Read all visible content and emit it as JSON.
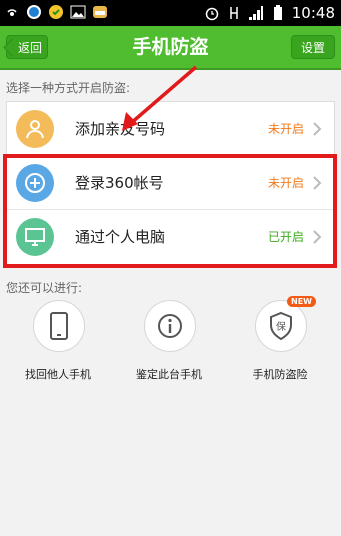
{
  "titlebar": {
    "back_label": "返回",
    "title": "手机防盗",
    "settings_label": "设置"
  },
  "statusbar": {
    "time": "10:48"
  },
  "section1_label": "选择一种方式开启防盗:",
  "options": [
    {
      "label": "添加亲友号码",
      "status": "未开启",
      "icon": "person-icon",
      "icon_color": "#f3bb5a",
      "status_color": "#f07a1e"
    },
    {
      "label": "登录360帐号",
      "status": "未开启",
      "icon": "plus-circle-icon",
      "icon_color": "#5aa7e6",
      "status_color": "#f07a1e"
    },
    {
      "label": "通过个人电脑",
      "status": "已开启",
      "icon": "monitor-icon",
      "icon_color": "#5bc493",
      "status_color": "#3faa21"
    }
  ],
  "section2_label": "您还可以进行:",
  "tiles": [
    {
      "label": "找回他人手机",
      "icon": "phone-icon"
    },
    {
      "label": "鉴定此台手机",
      "icon": "info-icon"
    },
    {
      "label": "手机防盗险",
      "icon": "shield-icon",
      "badge": "NEW",
      "shield_text": "保"
    }
  ],
  "colors": {
    "header_green": "#4fbd2f",
    "highlight_red": "#e11b1b",
    "arrow_red": "#e11b1b"
  }
}
